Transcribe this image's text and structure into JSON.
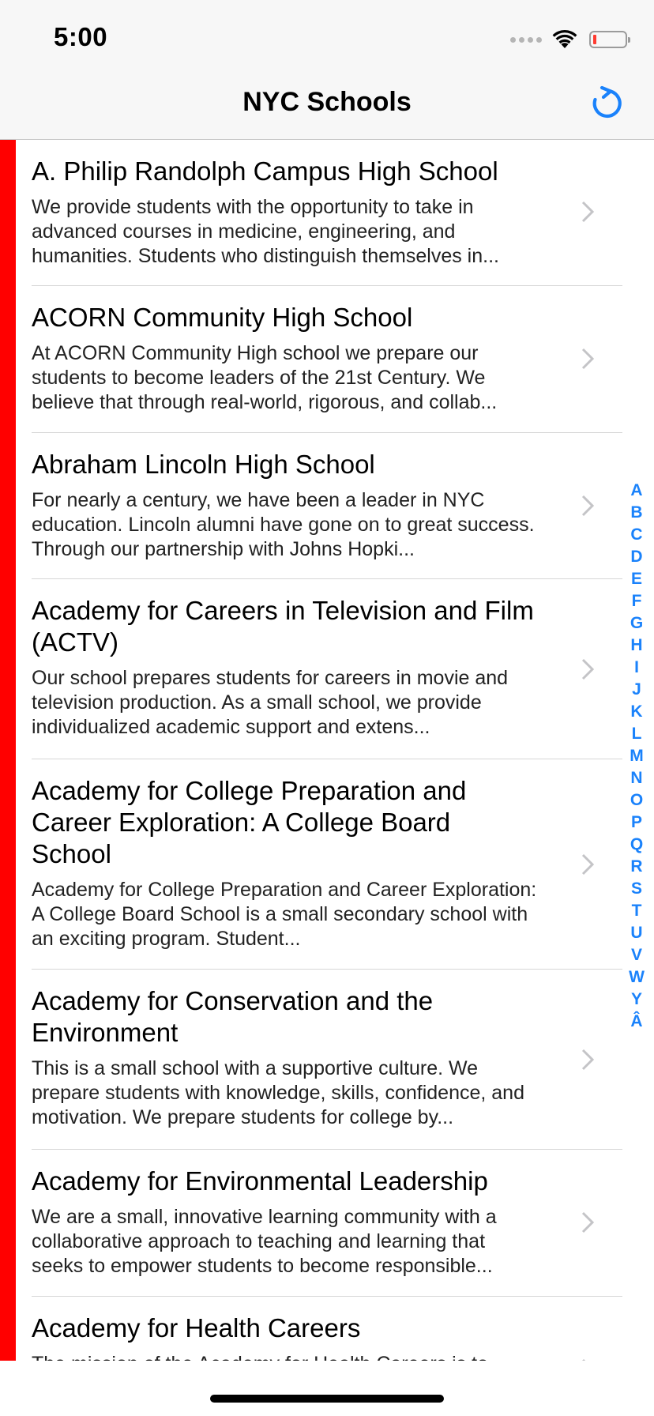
{
  "status_bar": {
    "time": "5:00"
  },
  "nav": {
    "title": "NYC Schools",
    "refresh_icon": "refresh-icon",
    "accent_color": "#1a82fb"
  },
  "list": {
    "accent_color": "#ff0000",
    "schools": [
      {
        "name": "A. Philip Randolph Campus High School",
        "description": "We provide students with the opportunity to take in advanced courses in medicine, engineering, and humanities. Students who distinguish themselves in..."
      },
      {
        "name": "ACORN Community High School",
        "description": "At ACORN Community High school we prepare our students to become leaders of the 21st Century. We believe that through real-world, rigorous, and collab..."
      },
      {
        "name": "Abraham Lincoln High School",
        "description": "For nearly a century, we have been a leader in NYC education. Lincoln alumni have gone on to great success. Through our partnership with Johns Hopki..."
      },
      {
        "name": "Academy for Careers in Television and Film (ACTV)",
        "description": "Our school prepares students for careers in movie and television production. As a small school, we provide individualized academic support and extens..."
      },
      {
        "name": "Academy for College Preparation and Career Exploration: A College Board School",
        "description": "Academy for College Preparation and Career Exploration: A College Board School is a small secondary school with an exciting program. Student..."
      },
      {
        "name": "Academy for Conservation and the Environment",
        "description": "This is a small school with a supportive culture. We prepare students with knowledge, skills, confidence, and motivation. We prepare students for college by..."
      },
      {
        "name": "Academy for Environmental Leadership",
        "description": "We are a small, innovative learning community with a collaborative approach to teaching and learning that seeks to empower students to become responsible..."
      },
      {
        "name": "Academy for Health Careers",
        "description": "The mission of the Academy for Health Careers is to..."
      }
    ]
  },
  "section_index": [
    "A",
    "B",
    "C",
    "D",
    "E",
    "F",
    "G",
    "H",
    "I",
    "J",
    "K",
    "L",
    "M",
    "N",
    "O",
    "P",
    "Q",
    "R",
    "S",
    "T",
    "U",
    "V",
    "W",
    "Y",
    "Â"
  ]
}
